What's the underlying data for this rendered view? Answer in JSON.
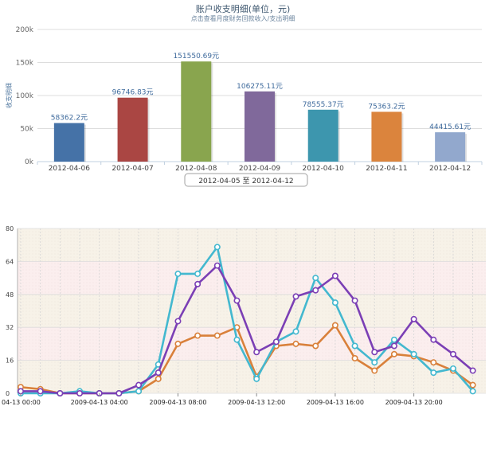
{
  "chart_data": [
    {
      "type": "bar",
      "title": "账户收支明细(单位，元)",
      "subtitle": "点击查看月度财务回款收入/支出明细",
      "ylabel": "收支明细",
      "ylim": [
        0,
        200000
      ],
      "ytick_labels": [
        "0k",
        "50k",
        "100k",
        "150k",
        "200k"
      ],
      "grid": true,
      "categories": [
        "2012-04-06",
        "2012-04-07",
        "2012-04-08",
        "2012-04-09",
        "2012-04-10",
        "2012-04-11",
        "2012-04-12"
      ],
      "values": [
        58362.2,
        96746.83,
        151550.69,
        106275.11,
        78555.37,
        75363.2,
        44415.61
      ],
      "data_labels": [
        "58362.2元",
        "96746.83元",
        "151550.69元",
        "106275.11元",
        "78555.37元",
        "75363.2元",
        "44415.61元"
      ],
      "colors": [
        "#4572a7",
        "#aa4643",
        "#89a54e",
        "#80699b",
        "#3d96ae",
        "#db843d",
        "#92a8cd"
      ],
      "range_button": "2012-04-05 至 2012-04-12"
    },
    {
      "type": "line",
      "ylim": [
        0,
        80
      ],
      "yticks": [
        0,
        16,
        32,
        48,
        64,
        80
      ],
      "ytick_labels": [
        "0",
        "16",
        "32",
        "48",
        "64",
        "80"
      ],
      "x_tick_labels": [
        "04-13 00:00",
        "2009-04-13 04:00",
        "2009-04-13 08:00",
        "2009-04-13 12:00",
        "2009-04-13 16:00",
        "2009-04-13 20:00"
      ],
      "x_tick_hours": [
        0,
        4,
        8,
        12,
        16,
        20
      ],
      "x_hours": [
        0,
        1,
        2,
        3,
        4,
        5,
        6,
        7,
        8,
        9,
        10,
        11,
        12,
        13,
        14,
        15,
        16,
        17,
        18,
        19,
        20,
        21,
        22,
        23
      ],
      "grid": true,
      "series": [
        {
          "color": "#7b3fb5",
          "values": [
            1,
            1,
            0,
            0,
            0,
            0,
            4,
            10,
            35,
            53,
            62,
            45,
            20,
            25,
            47,
            50,
            57,
            45,
            20,
            23,
            36,
            26,
            19,
            11
          ]
        },
        {
          "color": "#43b8cf",
          "values": [
            0,
            0,
            0,
            1,
            0,
            0,
            1,
            14,
            58,
            58,
            71,
            26,
            7,
            25,
            30,
            56,
            44,
            23,
            15,
            26,
            19,
            10,
            12,
            1
          ]
        },
        {
          "color": "#d9803a",
          "values": [
            3,
            2,
            0,
            0,
            0,
            0,
            1,
            7,
            24,
            28,
            28,
            32,
            8,
            23,
            24,
            23,
            33,
            17,
            11,
            19,
            18,
            15,
            11,
            4
          ]
        }
      ]
    }
  ]
}
